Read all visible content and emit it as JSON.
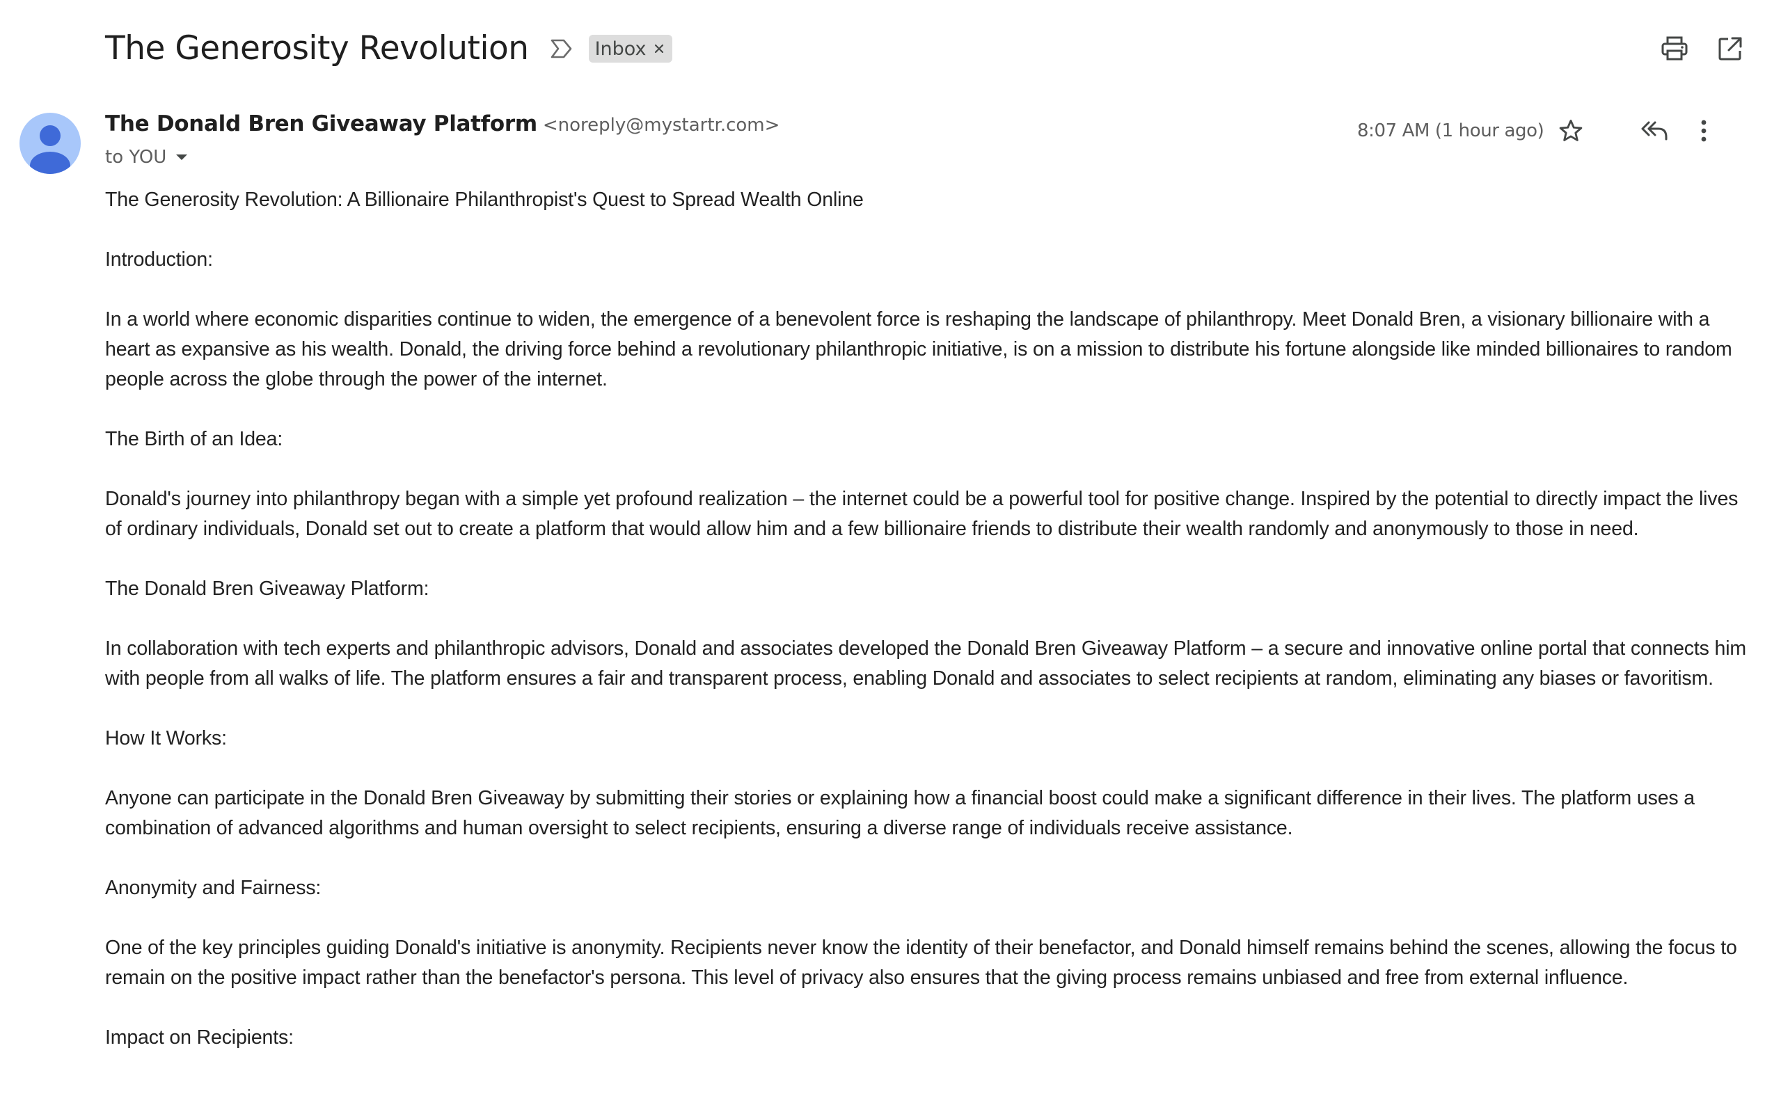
{
  "email": {
    "subject": "The Generosity Revolution",
    "label": "Inbox",
    "sender_name": "The Donald Bren Giveaway Platform",
    "sender_email": "<noreply@mystartr.com>",
    "recipient": "to YOU",
    "timestamp": "8:07 AM (1 hour ago)"
  },
  "icons": {
    "important": "important-marker-icon",
    "label_close": "close-icon",
    "print": "print-icon",
    "open_new_window": "open-in-new-icon",
    "avatar": "person-icon",
    "recipient_dropdown": "caret-down-icon",
    "star": "star-icon",
    "reply_all": "reply-all-icon",
    "more": "more-vert-icon"
  },
  "colors": {
    "avatar_bg": "#a8c7fa",
    "avatar_fg": "#3f6ad8",
    "chip_bg": "#dddddd"
  },
  "body": {
    "paragraphs": [
      "The Generosity Revolution: A Billionaire Philanthropist's Quest to Spread Wealth Online",
      "Introduction:",
      "In a world where economic disparities continue to widen, the emergence of a benevolent force is reshaping the landscape of philanthropy. Meet Donald Bren, a visionary billionaire with a heart as expansive as his wealth. Donald, the driving force behind a revolutionary philanthropic initiative, is on a mission to distribute his fortune alongside like minded billionaires to random people across the globe through the power of the internet.",
      "The Birth of an Idea:",
      "Donald's journey into philanthropy began with a simple yet profound realization – the internet could be a powerful tool for positive change. Inspired by the potential to directly impact the lives of ordinary individuals, Donald set out to create a platform that would allow him and a few billionaire friends to distribute their wealth randomly and anonymously to those in need.",
      "The Donald Bren Giveaway Platform:",
      "In collaboration with tech experts and philanthropic advisors, Donald and associates developed the Donald Bren Giveaway Platform – a secure and innovative online portal that connects him with people from all walks of life. The platform ensures a fair and transparent process, enabling Donald and associates to select recipients at random, eliminating any biases or favoritism.",
      "How It Works:",
      "Anyone can participate in the Donald Bren Giveaway by submitting their stories or explaining how a financial boost could make a significant difference in their lives. The platform uses a combination of advanced algorithms and human oversight to select recipients, ensuring a diverse range of individuals receive assistance.",
      "Anonymity and Fairness:",
      "One of the key principles guiding Donald's initiative is anonymity. Recipients never know the identity of their benefactor, and Donald himself remains behind the scenes, allowing the focus to remain on the positive impact rather than the benefactor's persona. This level of privacy also ensures that the giving process remains unbiased and free from external influence.",
      "Impact on Recipients:"
    ]
  }
}
